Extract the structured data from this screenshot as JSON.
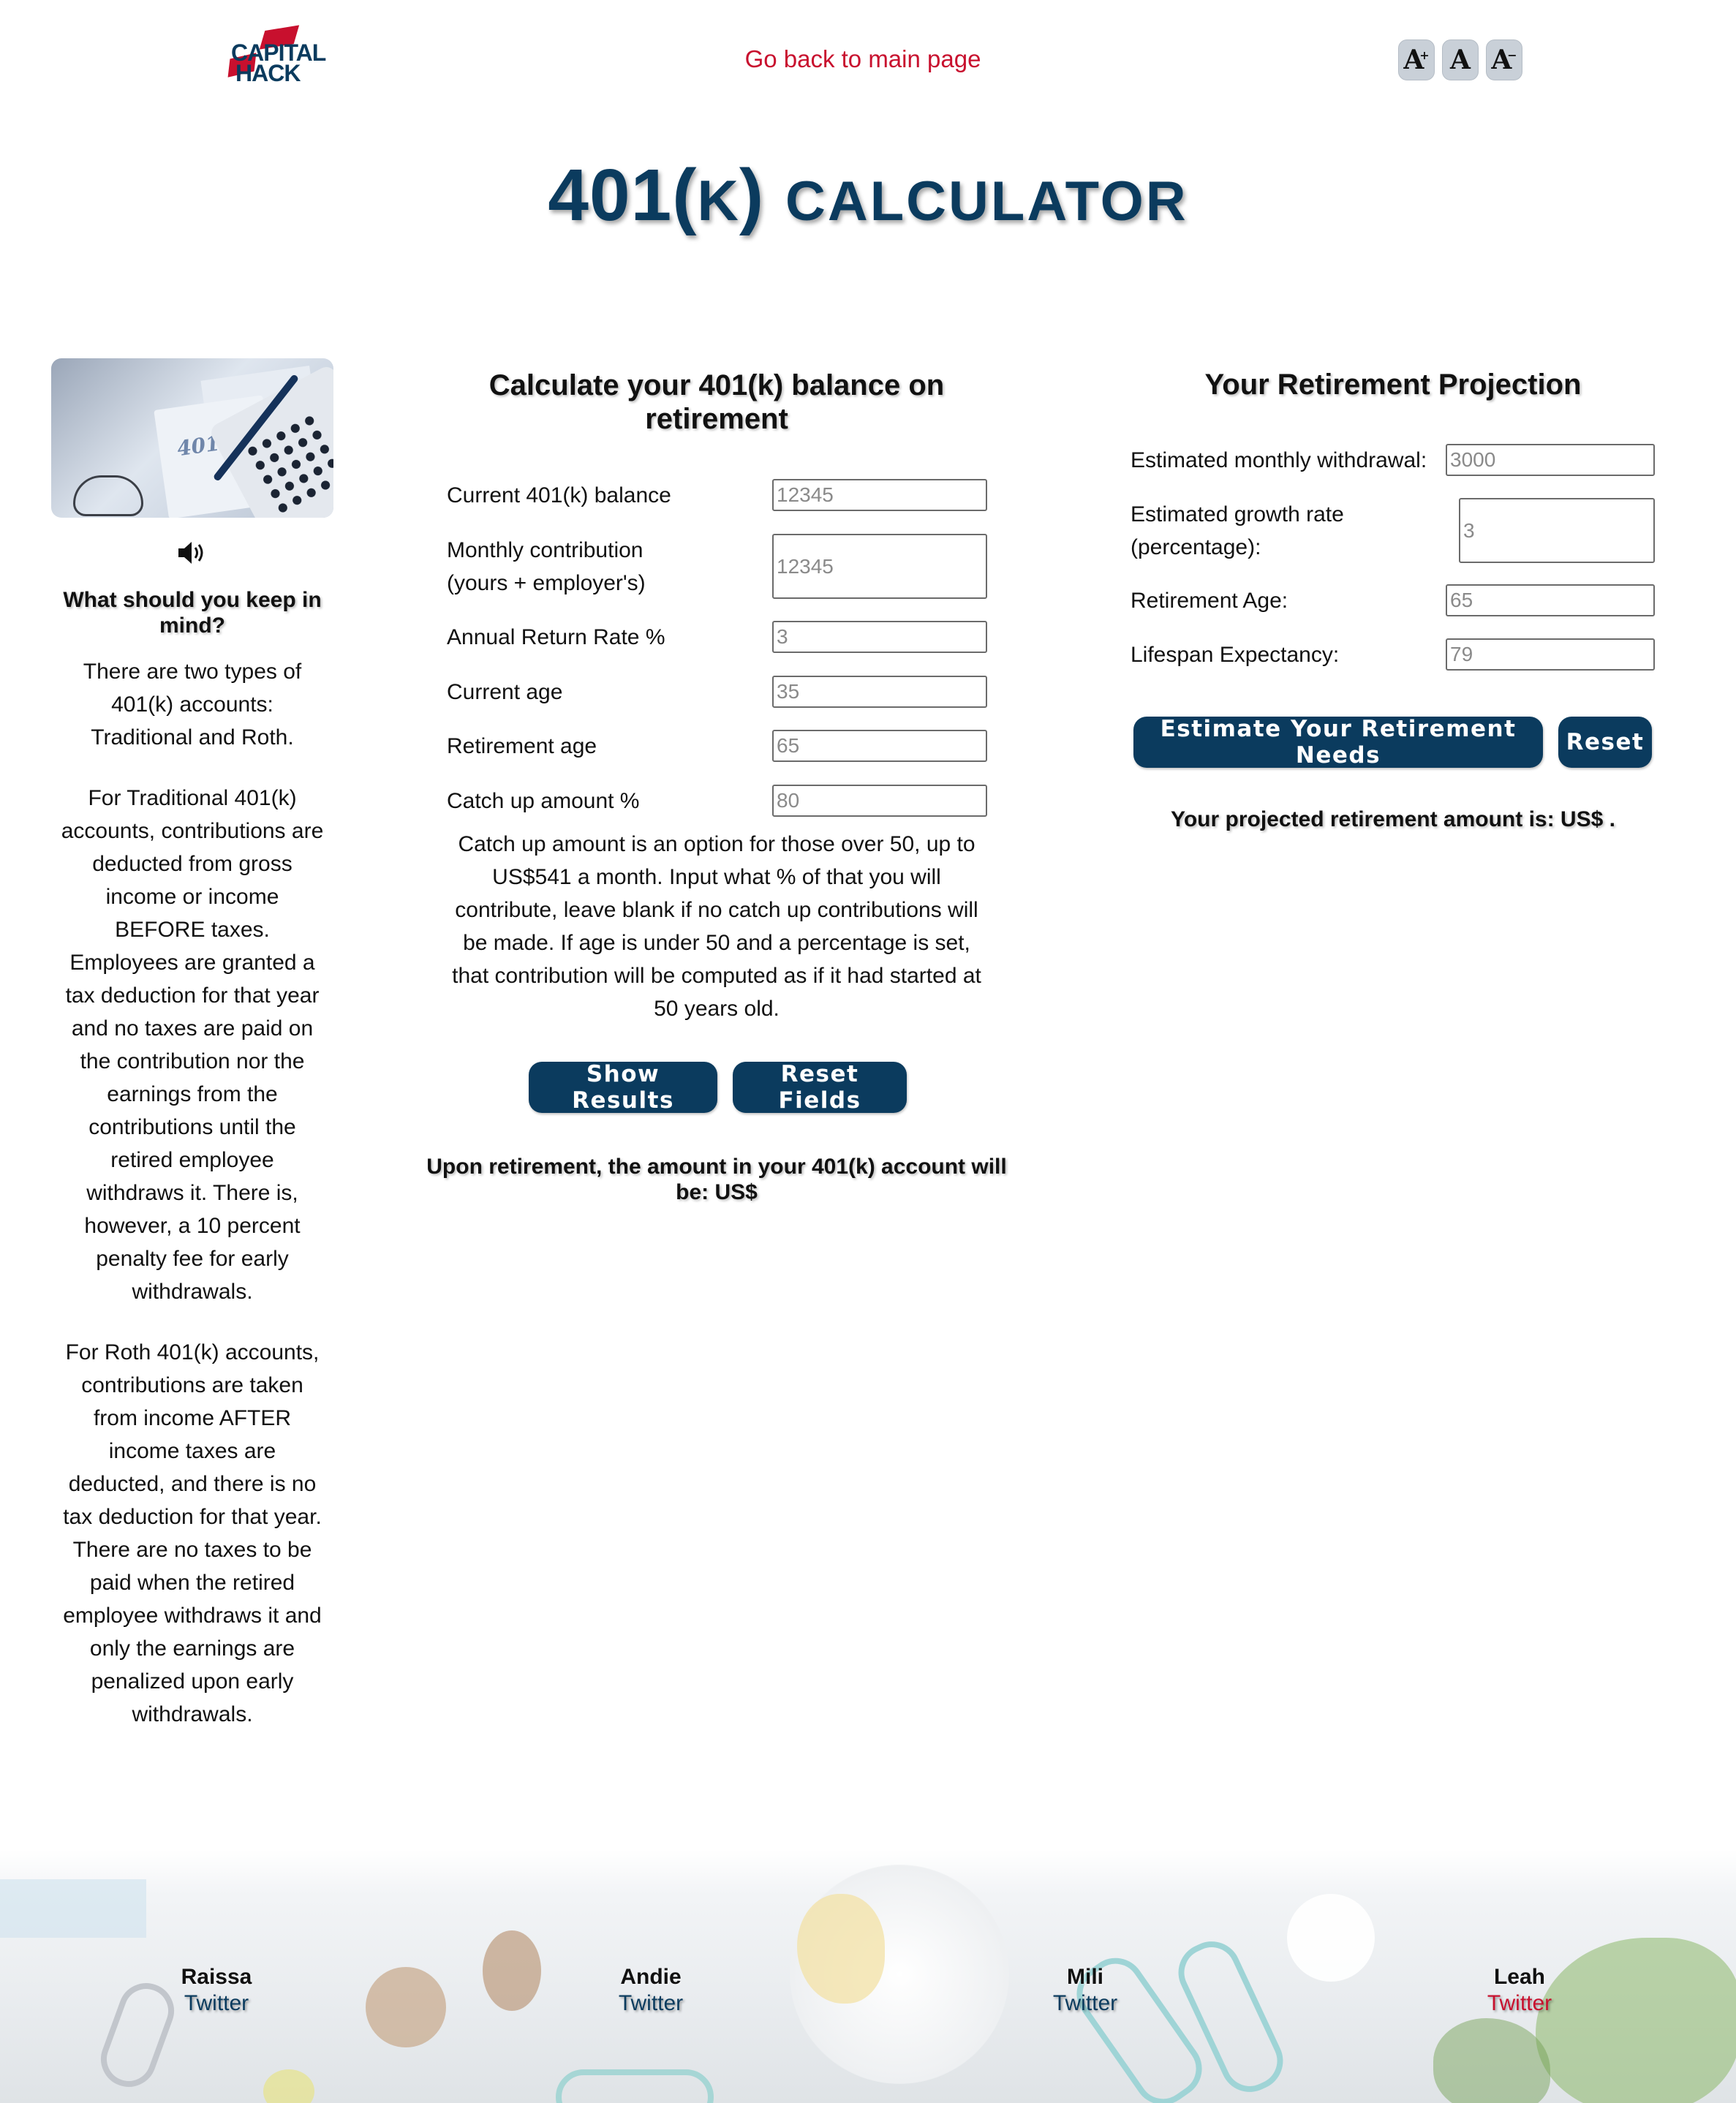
{
  "header": {
    "logo_line1": "CAPITAL",
    "logo_line2": "HACK",
    "back_link": "Go back to main page",
    "font_controls": [
      {
        "label": "A",
        "icon": "font-increase-icon"
      },
      {
        "label": "A",
        "icon": "font-reset-icon"
      },
      {
        "label": "A",
        "icon": "font-decrease-icon"
      }
    ]
  },
  "title": {
    "part1": "401(",
    "k": "K",
    "part2": ")",
    "calculator": "CALCULATOR",
    "color": "#0b3b5e"
  },
  "sidebar": {
    "image_text": "401k",
    "speaker_icon": "speaker-icon",
    "heading": "What should you keep in mind?",
    "paragraphs": [
      "There are two types of 401(k) accounts: Traditional and Roth.",
      "For Traditional 401(k) accounts, contributions are deducted from gross income or income BEFORE taxes. Employees are granted a tax deduction for that year and no taxes are paid on the contribution nor the earnings from the contributions until the retired employee withdraws it. There is, however, a 10 percent penalty fee for early withdrawals.",
      "For Roth 401(k) accounts, contributions are taken from income AFTER income taxes are deducted, and there is no tax deduction for that year. There are no taxes to be paid when the retired employee withdraws it and only the earnings are penalized upon early withdrawals."
    ]
  },
  "calculator": {
    "heading": "Calculate your 401(k) balance on retirement",
    "fields": [
      {
        "label": "Current 401(k) balance",
        "placeholder": "12345"
      },
      {
        "label": "Monthly contribution (yours + employer's)",
        "placeholder": "12345"
      },
      {
        "label": "Annual Return Rate %",
        "placeholder": "3"
      },
      {
        "label": "Current age",
        "placeholder": "35"
      },
      {
        "label": "Retirement age",
        "placeholder": "65"
      },
      {
        "label": "Catch up amount %",
        "placeholder": "80"
      }
    ],
    "note": "Catch up amount is an option for those over 50, up to US$541 a month. Input what % of that you will contribute, leave blank if no catch up contributions will be made. If age is under 50 and a percentage is set, that contribution will be computed as if it had started at 50 years old.",
    "show_button": "Show Results",
    "reset_button": "Reset Fields",
    "result_text": "Upon retirement, the amount in your 401(k) account will be: US$"
  },
  "projection": {
    "heading": "Your Retirement Projection",
    "fields": [
      {
        "label": "Estimated monthly withdrawal:",
        "placeholder": "3000"
      },
      {
        "label": "Estimated growth rate (percentage):",
        "placeholder": "3"
      },
      {
        "label": "Retirement Age:",
        "placeholder": "65"
      },
      {
        "label": "Lifespan Expectancy:",
        "placeholder": "79"
      }
    ],
    "estimate_button": "Estimate Your Retirement Needs",
    "reset_button": "Reset",
    "result_text": "Your projected retirement amount is: US$ ."
  },
  "footer": {
    "credits": [
      {
        "name": "Raissa",
        "link": "Twitter"
      },
      {
        "name": "Andie",
        "link": "Twitter"
      },
      {
        "name": "Mili",
        "link": "Twitter"
      },
      {
        "name": "Leah",
        "link": "Twitter"
      }
    ]
  },
  "colors": {
    "brand": "#0b3b5e",
    "accent_red": "#c8102e"
  }
}
